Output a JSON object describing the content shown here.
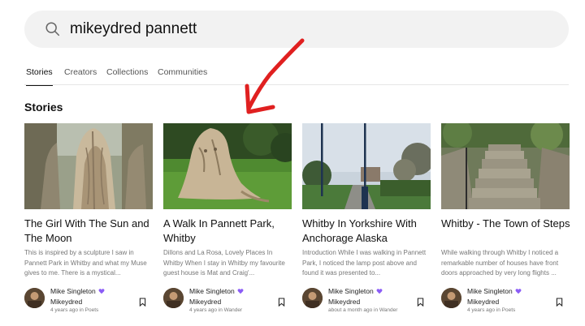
{
  "search": {
    "query": "mikeydred pannett"
  },
  "tabs": [
    {
      "label": "Stories",
      "active": true
    },
    {
      "label": "Creators",
      "active": false
    },
    {
      "label": "Collections",
      "active": false
    },
    {
      "label": "Communities",
      "active": false
    }
  ],
  "section_title": "Stories",
  "colors": {
    "accent": "#8b5cf6",
    "arrow": "#e02020",
    "muted_text": "#777777"
  },
  "stories": [
    {
      "title": "The Girl With The Sun and The Moon",
      "excerpt": "This is inspired by a sculpture I saw in Pannett Park in Whitby and what my Muse gives to me. There is a mystical...",
      "author": "Mike Singleton",
      "handle": "Mikeydred",
      "meta": "4 years ago in Poets",
      "thumb_icon": "wood-sculpture-image"
    },
    {
      "title": "A Walk In Pannett Park, Whitby",
      "excerpt": "Dillons and La Rosa, Lovely Places In Whitby When I stay in Whitby my favourite guest house is Mat and Craig'...",
      "author": "Mike Singleton",
      "handle": "Mikeydred",
      "meta": "4 years ago in Wander",
      "thumb_icon": "carved-tree-stump-image"
    },
    {
      "title": "Whitby In Yorkshire With Anchorage Alaska",
      "excerpt": "Introduction While I was walking in Pannett Park, I noticed the lamp post above and found it was presented to...",
      "author": "Mike Singleton",
      "handle": "Mikeydred",
      "meta": "about a month ago in Wander",
      "thumb_icon": "park-path-lamp-post-image"
    },
    {
      "title": "Whitby - The Town of Steps",
      "excerpt": "While walking through Whitby I noticed a remarkable number of houses have front doors approached by very long flights ...",
      "author": "Mike Singleton",
      "handle": "Mikeydred",
      "meta": "4 years ago in Poets",
      "thumb_icon": "stone-steps-image"
    }
  ]
}
